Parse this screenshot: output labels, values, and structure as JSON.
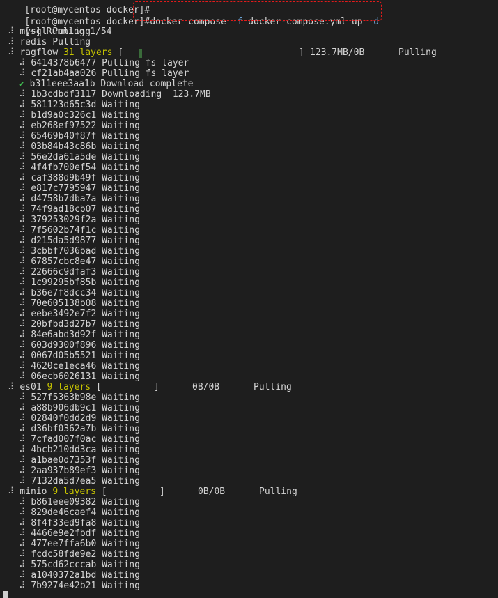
{
  "terminal": {
    "prev_prompt": "[root@mycentos docker]#",
    "prompt": "[root@mycentos docker]#",
    "command_parts": [
      "docker compose ",
      "-f",
      " docker-compose.yml up ",
      "-d"
    ],
    "running_status": "[+] Running 1/54",
    "bullet": "⠼",
    "check": "✔",
    "services_simple": [
      {
        "name": "mysql",
        "status": "Pulling"
      },
      {
        "name": "redis",
        "status": "Pulling"
      }
    ],
    "ragflow": {
      "name": "ragflow",
      "layers_label": "31 layers",
      "bar_open": "[",
      "bar_close": "]",
      "size": "123.7MB/0B",
      "status": "Pulling",
      "progress_fraction": 0.02,
      "layers": [
        {
          "id": "6414378b6477",
          "status": "Pulling fs layer"
        },
        {
          "id": "cf21ab4aa026",
          "status": "Pulling fs layer"
        },
        {
          "id": "b311eee3aa1b",
          "status": "Download complete",
          "done": true
        },
        {
          "id": "1b3cdbdf3117",
          "status": "Downloading  123.7MB"
        },
        {
          "id": "581123d65c3d",
          "status": "Waiting"
        },
        {
          "id": "b1d9a0c326c1",
          "status": "Waiting"
        },
        {
          "id": "eb268ef97522",
          "status": "Waiting"
        },
        {
          "id": "65469b40f87f",
          "status": "Waiting"
        },
        {
          "id": "03b84b43c86b",
          "status": "Waiting"
        },
        {
          "id": "56e2da61a5de",
          "status": "Waiting"
        },
        {
          "id": "4f4fb700ef54",
          "status": "Waiting"
        },
        {
          "id": "caf388d9b49f",
          "status": "Waiting"
        },
        {
          "id": "e817c7795947",
          "status": "Waiting"
        },
        {
          "id": "d4758b7dba7a",
          "status": "Waiting"
        },
        {
          "id": "74f9ad18cb07",
          "status": "Waiting"
        },
        {
          "id": "379253029f2a",
          "status": "Waiting"
        },
        {
          "id": "7f5602b74f1c",
          "status": "Waiting"
        },
        {
          "id": "d215da5d9877",
          "status": "Waiting"
        },
        {
          "id": "3cbbf7036bad",
          "status": "Waiting"
        },
        {
          "id": "67857cbc8e47",
          "status": "Waiting"
        },
        {
          "id": "22666c9dfaf3",
          "status": "Waiting"
        },
        {
          "id": "1c99295bf85b",
          "status": "Waiting"
        },
        {
          "id": "b36e7f8dcc34",
          "status": "Waiting"
        },
        {
          "id": "70e605138b08",
          "status": "Waiting"
        },
        {
          "id": "eebe3492e7f2",
          "status": "Waiting"
        },
        {
          "id": "20bfbd3d27b7",
          "status": "Waiting"
        },
        {
          "id": "84e6abd3d92f",
          "status": "Waiting"
        },
        {
          "id": "603d9300f896",
          "status": "Waiting"
        },
        {
          "id": "0067d05b5521",
          "status": "Waiting"
        },
        {
          "id": "4620ce1eca46",
          "status": "Waiting"
        },
        {
          "id": "06ecb6026131",
          "status": "Waiting"
        }
      ]
    },
    "es01": {
      "name": "es01",
      "layers_label": "9 layers",
      "bar_open": "[",
      "bar_close": "]",
      "size": "0B/0B",
      "status": "Pulling",
      "layers": [
        {
          "id": "527f5363b98e",
          "status": "Waiting"
        },
        {
          "id": "a88b906db9c1",
          "status": "Waiting"
        },
        {
          "id": "02840f0dd2d9",
          "status": "Waiting"
        },
        {
          "id": "d36bf0362a7b",
          "status": "Waiting"
        },
        {
          "id": "7cfad007f0ac",
          "status": "Waiting"
        },
        {
          "id": "4bcb210dd3ca",
          "status": "Waiting"
        },
        {
          "id": "a1bae0d7353f",
          "status": "Waiting"
        },
        {
          "id": "2aa937b89ef3",
          "status": "Waiting"
        },
        {
          "id": "7132da5d7ea5",
          "status": "Waiting"
        }
      ]
    },
    "minio": {
      "name": "minio",
      "layers_label": "9 layers",
      "bar_open": "[",
      "bar_close": "]",
      "size": "0B/0B",
      "status": "Pulling",
      "layers": [
        {
          "id": "b861eee09382",
          "status": "Waiting"
        },
        {
          "id": "829de46caef4",
          "status": "Waiting"
        },
        {
          "id": "8f4f33ed9fa8",
          "status": "Waiting"
        },
        {
          "id": "4466e9e2fbdf",
          "status": "Waiting"
        },
        {
          "id": "477ee7ffa6b0",
          "status": "Waiting"
        },
        {
          "id": "fcdc58fde9e2",
          "status": "Waiting"
        },
        {
          "id": "575cd62cccab",
          "status": "Waiting"
        },
        {
          "id": "a1040372a1bd",
          "status": "Waiting"
        },
        {
          "id": "7b9274e42b21",
          "status": "Waiting"
        }
      ]
    },
    "colors": {
      "background": "#1e1e1e",
      "text": "#d4d4d4",
      "layer_count": "#c7c400",
      "done_check": "#3fb950",
      "flag": "#6ea6d8",
      "highlight_border": "#e21b1b"
    }
  }
}
